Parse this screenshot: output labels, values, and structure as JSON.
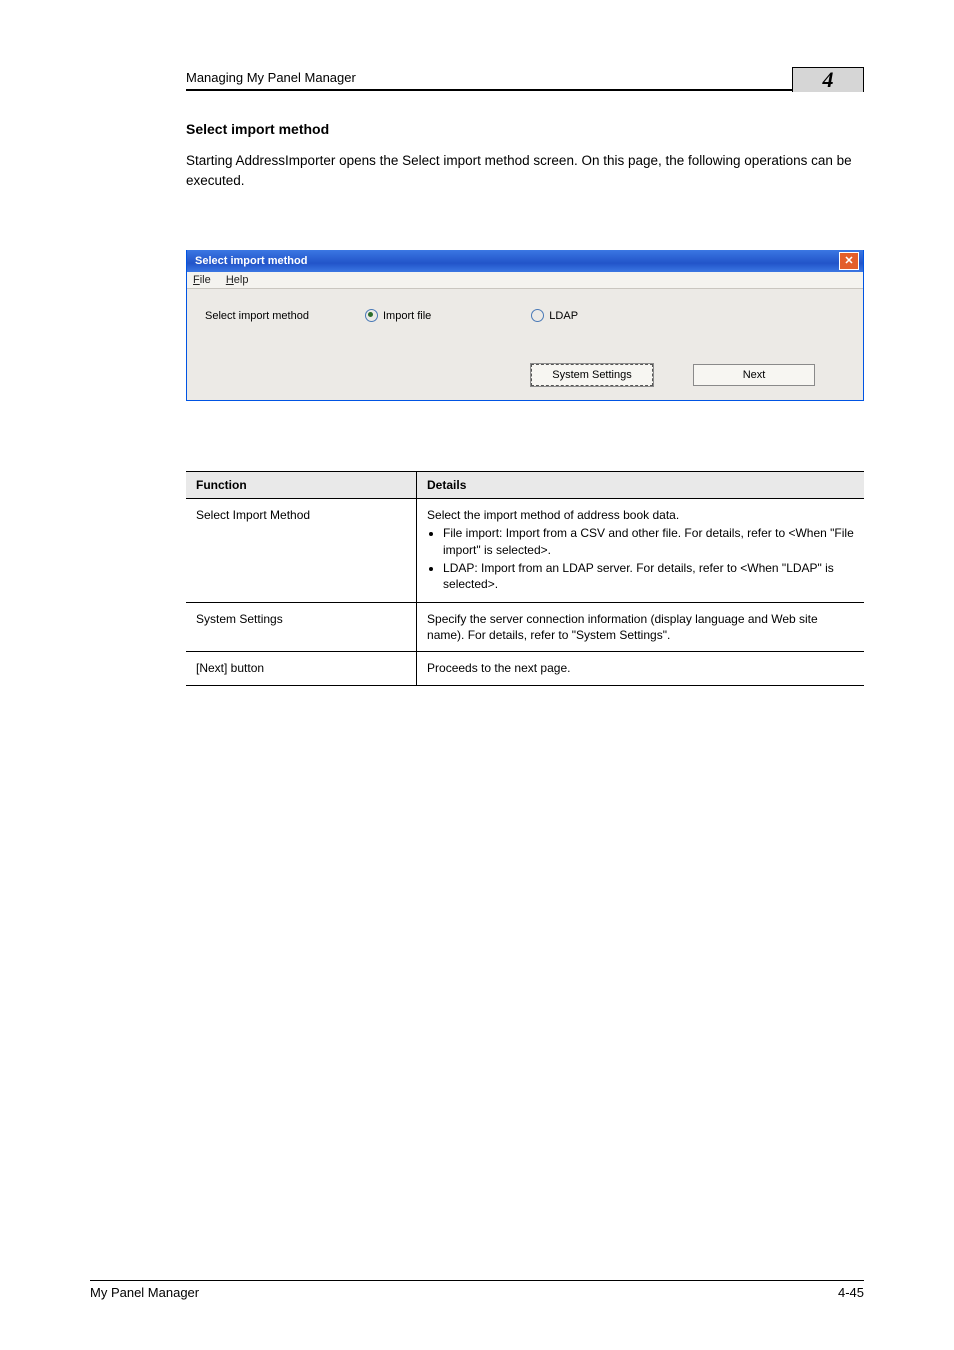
{
  "header": {
    "running_title": "Managing My Panel Manager",
    "chapter_number": "4"
  },
  "section": {
    "heading": "Select import method",
    "paragraph": "Starting AddressImporter opens the Select import method screen. On this page, the following operations can be executed."
  },
  "dialog": {
    "title": "Select import method",
    "menu_file": "File",
    "menu_help": "Help",
    "label": "Select import method",
    "radio_import_file": "Import file",
    "radio_ldap": "LDAP",
    "btn_system_settings": "System Settings",
    "btn_next": "Next"
  },
  "table": {
    "head_function": "Function",
    "head_details": "Details",
    "rows": [
      {
        "fn": "Select Import Method",
        "intro": "Select the import method of address book data.",
        "b1": "File import: Import from a CSV and other file. For details, refer to <When \"File import\" is selected>.",
        "b2": "LDAP: Import from an LDAP server. For details, refer to <When \"LDAP\" is selected>."
      },
      {
        "fn": "System Settings",
        "desc": "Specify the server connection information (display language and Web site name). For details, refer to \"System Settings\"."
      },
      {
        "fn": "[Next] button",
        "desc": "Proceeds to the next page."
      }
    ]
  },
  "footer": {
    "product": "My Panel Manager",
    "page": "4-45"
  }
}
